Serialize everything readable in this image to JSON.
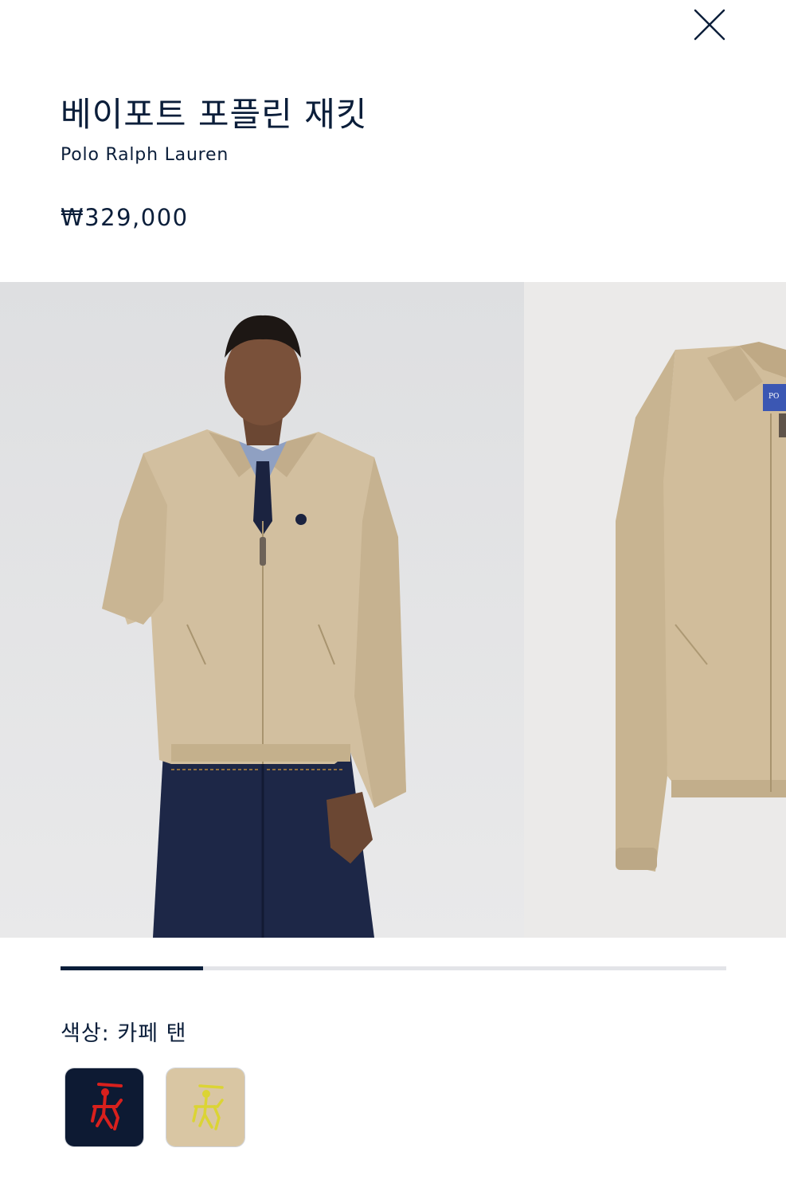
{
  "product": {
    "title": "베이포트 포플린 재킷",
    "brand": "Polo Ralph Lauren",
    "price": "₩329,000"
  },
  "gallery": {
    "images": [
      {
        "icon": "model-wearing-jacket-photo"
      },
      {
        "icon": "jacket-flat-product-photo"
      }
    ],
    "progress": 0.214
  },
  "colors": {
    "label": "색상: 카페 탠",
    "swatches": [
      {
        "icon": "navy-swatch-red-pony-logo",
        "bg": "#0d1a33",
        "logo": "#d8201d"
      },
      {
        "icon": "tan-swatch-yellow-pony-logo",
        "bg": "#d9c6a3",
        "logo": "#dbd434"
      }
    ]
  },
  "theme": {
    "text": "#0b1e3a",
    "track": "#e3e4e8",
    "photo_bg": "#e6e6e6",
    "jacket": "#d2bf9f"
  }
}
